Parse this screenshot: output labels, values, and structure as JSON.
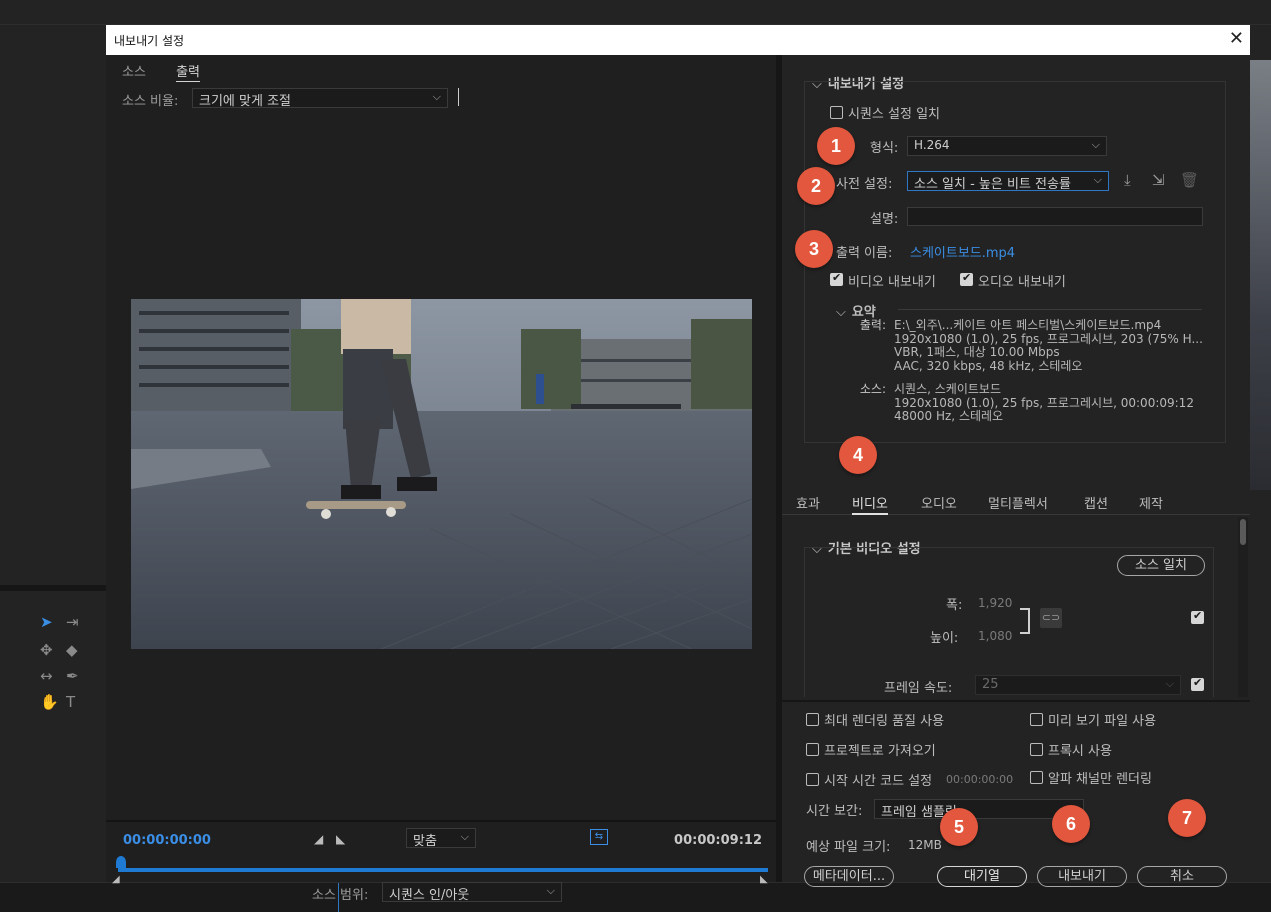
{
  "dialog": {
    "title": "내보내기 설정",
    "close": "✕"
  },
  "left": {
    "tabs": [
      "소스",
      "출력"
    ],
    "source_ratio_label": "소스 비율:",
    "source_ratio_value": "크기에 맞게 조절",
    "timecode_start": "00:00:00:00",
    "timecode_end": "00:00:09:12",
    "zoom_value": "맞춤",
    "range_label": "소스 범위:",
    "range_value": "시퀀스 인/아웃"
  },
  "export": {
    "section": "내보내기 설정",
    "match_sequence": "시퀀스 설정 일치",
    "format_label": "형식:",
    "format_value": "H.264",
    "preset_label": "사전 설정:",
    "preset_value": "소스 일치 - 높은 비트 전송률",
    "comment_label": "설명:",
    "output_label": "출력 이름:",
    "output_value": "스케이트보드.mp4",
    "export_video": "비디오 내보내기",
    "export_audio": "오디오 내보내기",
    "summary_head": "요약",
    "summary": {
      "out_key": "출력:",
      "out_lines": [
        "E:\\_외주\\...케이트 아트 페스티벌\\스케이트보드.mp4",
        "1920x1080 (1.0), 25 fps, 프로그레시브, 203 (75% H...",
        "VBR, 1패스, 대상 10.00 Mbps",
        "AAC, 320 kbps, 48 kHz, 스테레오"
      ],
      "src_key": "소스:",
      "src_lines": [
        "시퀀스, 스케이트보드",
        "1920x1080 (1.0), 25 fps, 프로그레시브, 00:00:09:12",
        "48000 Hz, 스테레오"
      ]
    }
  },
  "tabs": [
    "효과",
    "비디오",
    "오디오",
    "멀티플렉서",
    "캡션",
    "제작"
  ],
  "video": {
    "section": "기본 비디오 설정",
    "match_source": "소스 일치",
    "width_label": "폭:",
    "width_value": "1,920",
    "height_label": "높이:",
    "height_value": "1,080",
    "fps_label": "프레임 속도:",
    "fps_value": "25"
  },
  "options": {
    "max_render": "최대 렌더링 품질 사용",
    "use_previews": "미리 보기 파일 사용",
    "import_project": "프로젝트로 가져오기",
    "use_proxies": "프록시 사용",
    "start_tc": "시작 시간 코드 설정",
    "start_tc_value": "00:00:00:00",
    "alpha_only": "알파 채널만 렌더링",
    "interp_label": "시간 보간:",
    "interp_value": "프레임 샘플링",
    "filesize_label": "예상 파일 크기:",
    "filesize_value": "12MB"
  },
  "buttons": {
    "metadata": "메타데이터...",
    "queue": "대기열",
    "export": "내보내기",
    "cancel": "취소"
  },
  "badges": [
    "1",
    "2",
    "3",
    "4",
    "5",
    "6",
    "7"
  ],
  "colors": {
    "accent": "#3a8ee6",
    "badge": "#e2573d"
  }
}
